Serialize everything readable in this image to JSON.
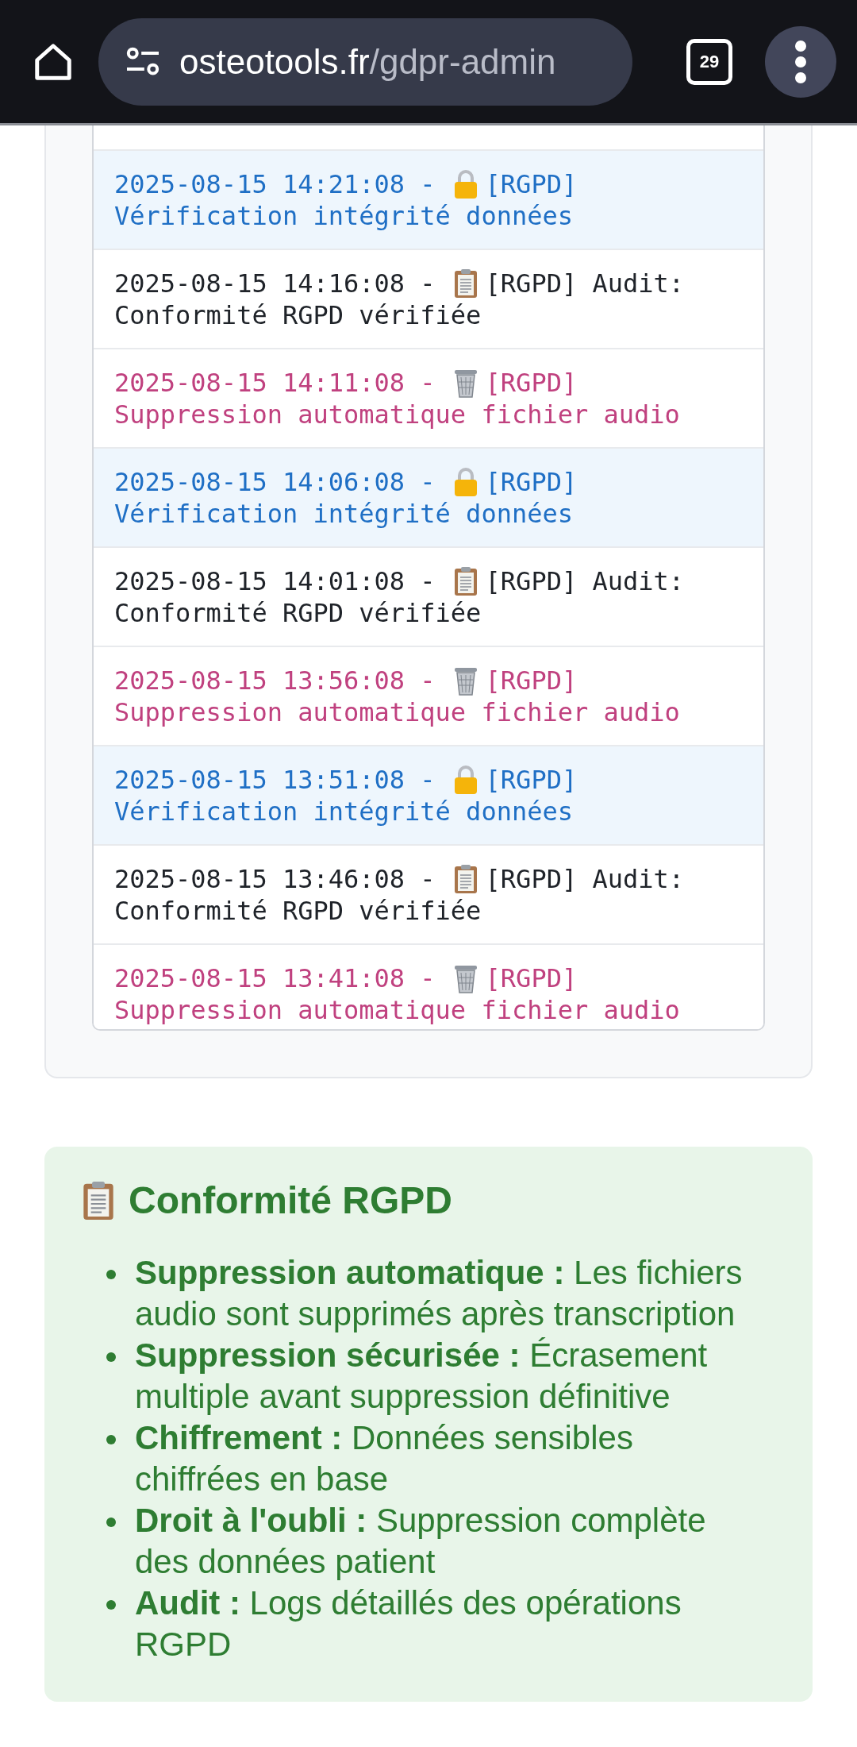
{
  "browser": {
    "url_host": "osteotools.fr",
    "url_path": "/gdpr-admin",
    "tab_count": "29"
  },
  "log": {
    "entries": [
      {
        "kind": "integrity",
        "time": "2025-08-15 14:21:08 -",
        "head": "[RGPD]",
        "body": "Vérification intégrité données"
      },
      {
        "kind": "audit",
        "time": "2025-08-15 14:16:08 -",
        "head": "[RGPD] Audit:",
        "body": "Conformité RGPD vérifiée"
      },
      {
        "kind": "deletion",
        "time": "2025-08-15 14:11:08 -",
        "head": "[RGPD]",
        "body": "Suppression automatique fichier audio"
      },
      {
        "kind": "integrity",
        "time": "2025-08-15 14:06:08 -",
        "head": "[RGPD]",
        "body": "Vérification intégrité données"
      },
      {
        "kind": "audit",
        "time": "2025-08-15 14:01:08 -",
        "head": "[RGPD] Audit:",
        "body": "Conformité RGPD vérifiée"
      },
      {
        "kind": "deletion",
        "time": "2025-08-15 13:56:08 -",
        "head": "[RGPD]",
        "body": "Suppression automatique fichier audio"
      },
      {
        "kind": "integrity",
        "time": "2025-08-15 13:51:08 -",
        "head": "[RGPD]",
        "body": "Vérification intégrité données"
      },
      {
        "kind": "audit",
        "time": "2025-08-15 13:46:08 -",
        "head": "[RGPD] Audit:",
        "body": "Conformité RGPD vérifiée"
      },
      {
        "kind": "deletion",
        "time": "2025-08-15 13:41:08 -",
        "head": "[RGPD]",
        "body": "Suppression automatique fichier audio"
      }
    ]
  },
  "compliance": {
    "title": "Conformité RGPD",
    "items": [
      "**Suppression automatique :** Les fichiers audio sont supprimés après transcription",
      "**Suppression sécurisée :** Écrasement multiple avant suppression définitive",
      "**Chiffrement :** Données sensibles chiffrées en base",
      "**Droit à l'oubli :** Suppression complète des données patient",
      "**Audit :** Logs détaillés des opérations RGPD"
    ]
  }
}
